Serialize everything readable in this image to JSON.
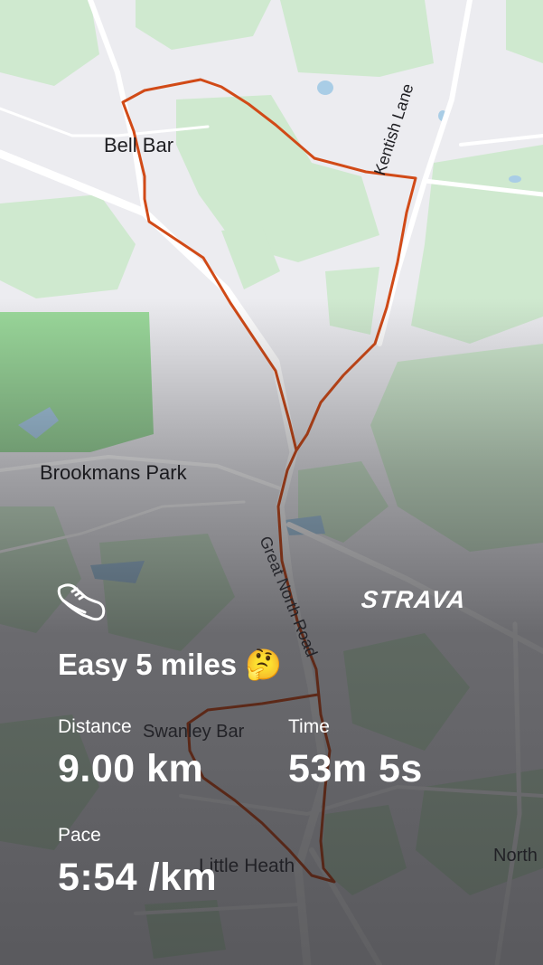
{
  "map": {
    "place_labels": [
      {
        "name": "label-bell-bar",
        "text": "Bell Bar"
      },
      {
        "name": "label-brookmans-park",
        "text": "Brookmans Park"
      },
      {
        "name": "label-swanley-bar",
        "text": "Swanley Bar"
      },
      {
        "name": "label-little-heath",
        "text": "Little Heath"
      },
      {
        "name": "label-north",
        "text": "North"
      }
    ],
    "road_labels": [
      {
        "name": "label-kentish-lane",
        "text": "Kentish Lane"
      },
      {
        "name": "label-great-north-road",
        "text": "Great North Road"
      }
    ],
    "route_color": "#d14a17",
    "park_color": "#cfe9cf"
  },
  "activity": {
    "icon": "running-shoe-icon",
    "brand": "STRAVA",
    "title": "Easy 5 miles 🤔",
    "stats": {
      "distance": {
        "label": "Distance",
        "value": "9.00 km"
      },
      "time": {
        "label": "Time",
        "value": "53m 5s"
      },
      "pace": {
        "label": "Pace",
        "value": "5:54 /km"
      }
    }
  }
}
